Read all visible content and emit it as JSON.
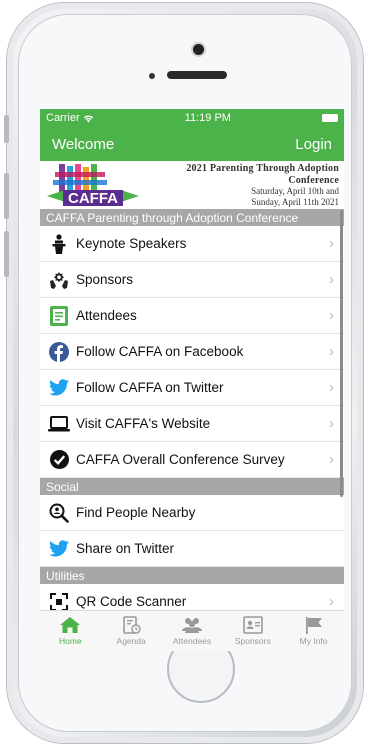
{
  "status_bar": {
    "carrier": "Carrier",
    "time": "11:19 PM"
  },
  "nav": {
    "left": "Welcome",
    "right": "Login"
  },
  "banner": {
    "logo_text": "CAFFA",
    "line1": "2021 Parenting Through Adoption Conference",
    "line2": "Saturday, April 10th and",
    "line3": "Sunday, April 11th 2021"
  },
  "sections": [
    {
      "title": "CAFFA Parenting through Adoption Conference",
      "items": [
        {
          "label": "Keynote Speakers",
          "icon": "speaker-podium-icon"
        },
        {
          "label": "Sponsors",
          "icon": "sponsors-hands-icon"
        },
        {
          "label": "Attendees",
          "icon": "attendees-document-icon"
        },
        {
          "label": "Follow CAFFA on Facebook",
          "icon": "facebook-icon"
        },
        {
          "label": "Follow CAFFA on Twitter",
          "icon": "twitter-icon"
        },
        {
          "label": "Visit CAFFA's Website",
          "icon": "laptop-icon"
        },
        {
          "label": "CAFFA Overall Conference Survey",
          "icon": "checkmark-circle-icon"
        }
      ]
    },
    {
      "title": "Social",
      "items": [
        {
          "label": "Find People Nearby",
          "icon": "search-people-icon"
        },
        {
          "label": "Share on Twitter",
          "icon": "twitter-icon"
        }
      ]
    },
    {
      "title": "Utilities",
      "items": [
        {
          "label": "QR Code Scanner",
          "icon": "qr-scan-icon"
        }
      ]
    }
  ],
  "tabs": [
    {
      "label": "Home",
      "icon": "home-icon",
      "active": true
    },
    {
      "label": "Agenda",
      "icon": "agenda-icon",
      "active": false
    },
    {
      "label": "Attendees",
      "icon": "attendees-icon",
      "active": false
    },
    {
      "label": "Sponsors",
      "icon": "sponsors-icon",
      "active": false
    },
    {
      "label": "My Info",
      "icon": "flag-icon",
      "active": false
    }
  ],
  "colors": {
    "accent": "#4cb24a",
    "section_header": "#a7a7a7",
    "facebook": "#3b5998",
    "twitter": "#1da1f2"
  }
}
